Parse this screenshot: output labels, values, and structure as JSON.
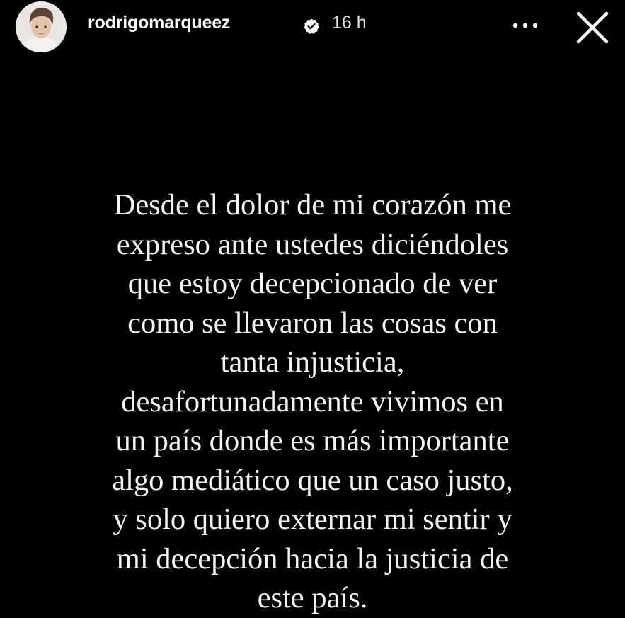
{
  "story": {
    "header": {
      "avatar_icon": "user-avatar",
      "username": "rodrigomarqueez",
      "verified_icon": "verified-badge-icon",
      "timestamp": "16 h",
      "more_icon": "more-options-icon",
      "close_icon": "close-icon"
    },
    "text_lines": [
      "Desde el dolor de mi corazón me",
      "expreso ante ustedes diciéndoles",
      "que estoy decepcionado de ver",
      "como se llevaron las cosas con",
      "tanta injusticia,",
      "desafortunadamente vivimos en",
      "un país donde es más importante",
      "algo mediático que un caso justo,",
      "y solo quiero externar mi sentir y",
      "mi decepción hacia la justicia de",
      "este país."
    ]
  },
  "colors": {
    "background": "#000000",
    "text": "#ffffff"
  }
}
